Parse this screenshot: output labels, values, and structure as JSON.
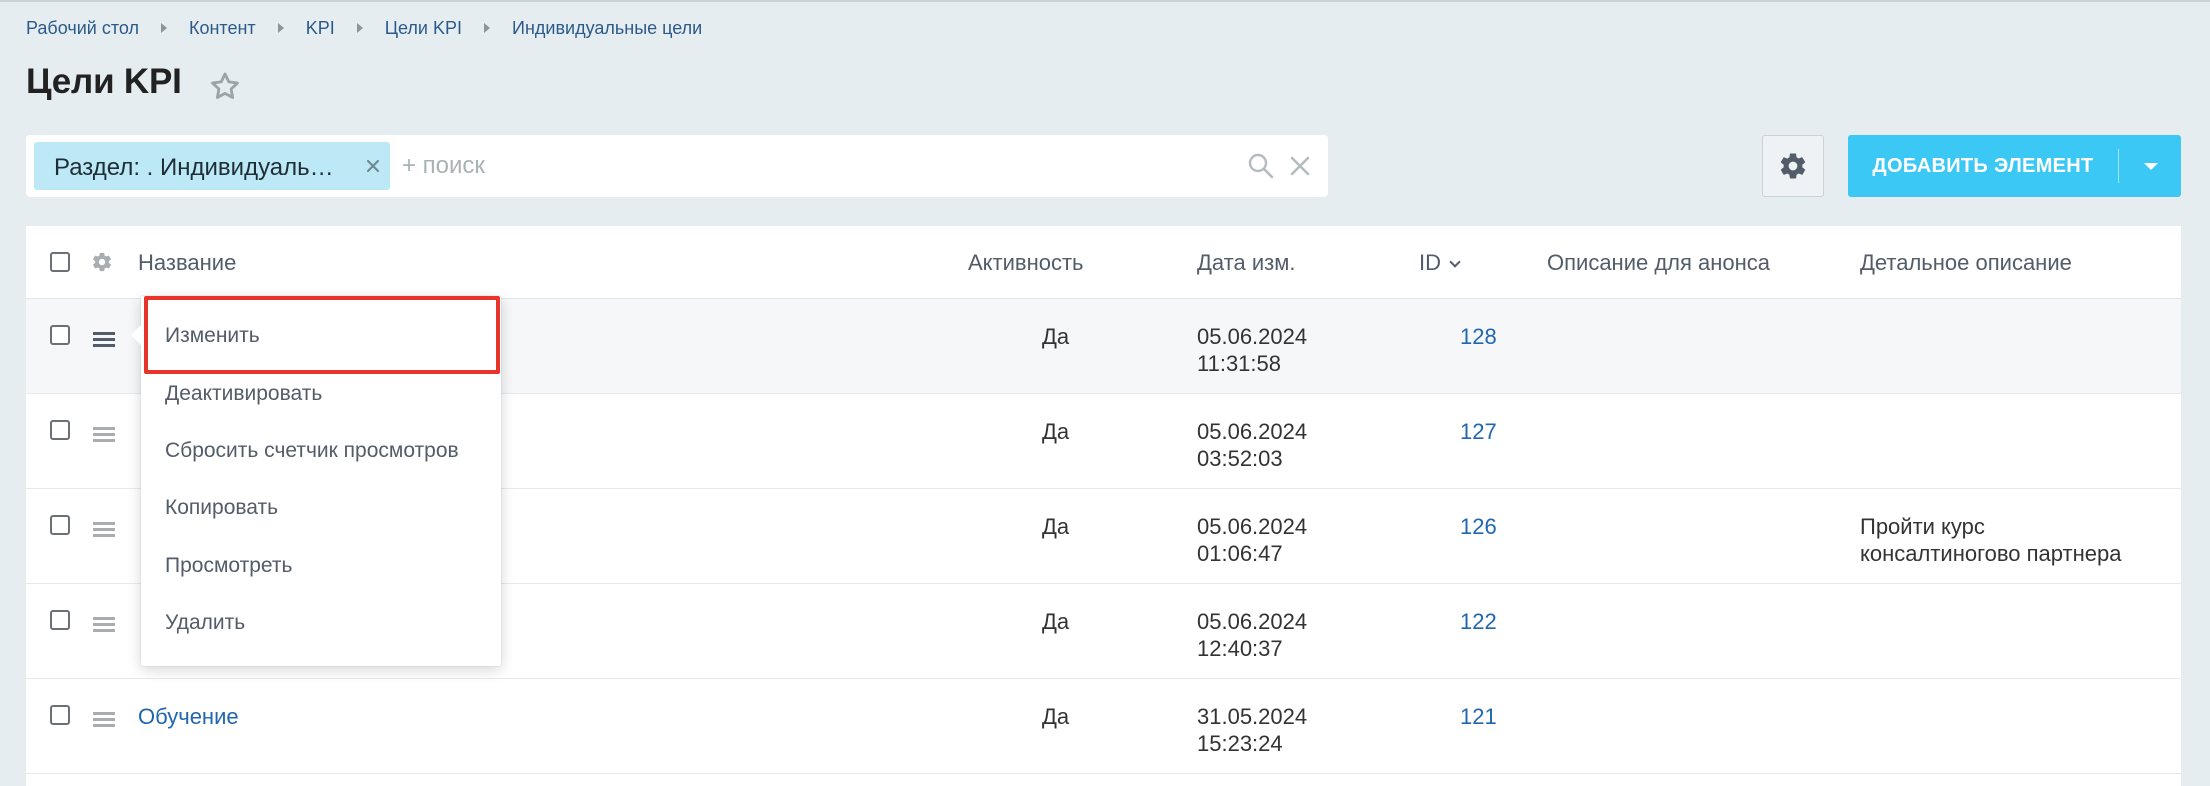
{
  "breadcrumbs": [
    "Рабочий стол",
    "Контент",
    "KPI",
    "Цели KPI",
    "Индивидуальные цели"
  ],
  "page_title": "Цели KPI",
  "filter": {
    "chip_label": "Раздел: . Индивидуальные цели",
    "search_placeholder": "+ поиск"
  },
  "toolbar": {
    "add_button_label": "ДОБАВИТЬ ЭЛЕМЕНТ"
  },
  "table": {
    "columns": {
      "name": "Название",
      "activity": "Активность",
      "date": "Дата изм.",
      "id": "ID",
      "announce": "Описание для анонса",
      "detail": "Детальное описание"
    },
    "rows": [
      {
        "name": "",
        "active": "Да",
        "date": "05.06.2024",
        "time": "11:31:58",
        "id": "128",
        "detail": ""
      },
      {
        "name": "",
        "active": "Да",
        "date": "05.06.2024",
        "time": "03:52:03",
        "id": "127",
        "detail": ""
      },
      {
        "name": "",
        "active": "Да",
        "date": "05.06.2024",
        "time": "01:06:47",
        "id": "126",
        "detail_line1": "Пройти курс",
        "detail_line2": "консалтиногово партнера"
      },
      {
        "name": "",
        "active": "Да",
        "date": "05.06.2024",
        "time": "12:40:37",
        "id": "122",
        "detail": ""
      },
      {
        "name": "Обучение",
        "active": "Да",
        "date": "31.05.2024",
        "time": "15:23:24",
        "id": "121",
        "detail": ""
      }
    ]
  },
  "context_menu": {
    "items": [
      "Изменить",
      "Деактивировать",
      "Сбросить счетчик просмотров",
      "Копировать",
      "Просмотреть",
      "Удалить"
    ],
    "highlight_color": "#e8352b"
  },
  "colors": {
    "accent": "#3bc8f5",
    "link": "#2067b0",
    "background": "#e6edf0"
  }
}
